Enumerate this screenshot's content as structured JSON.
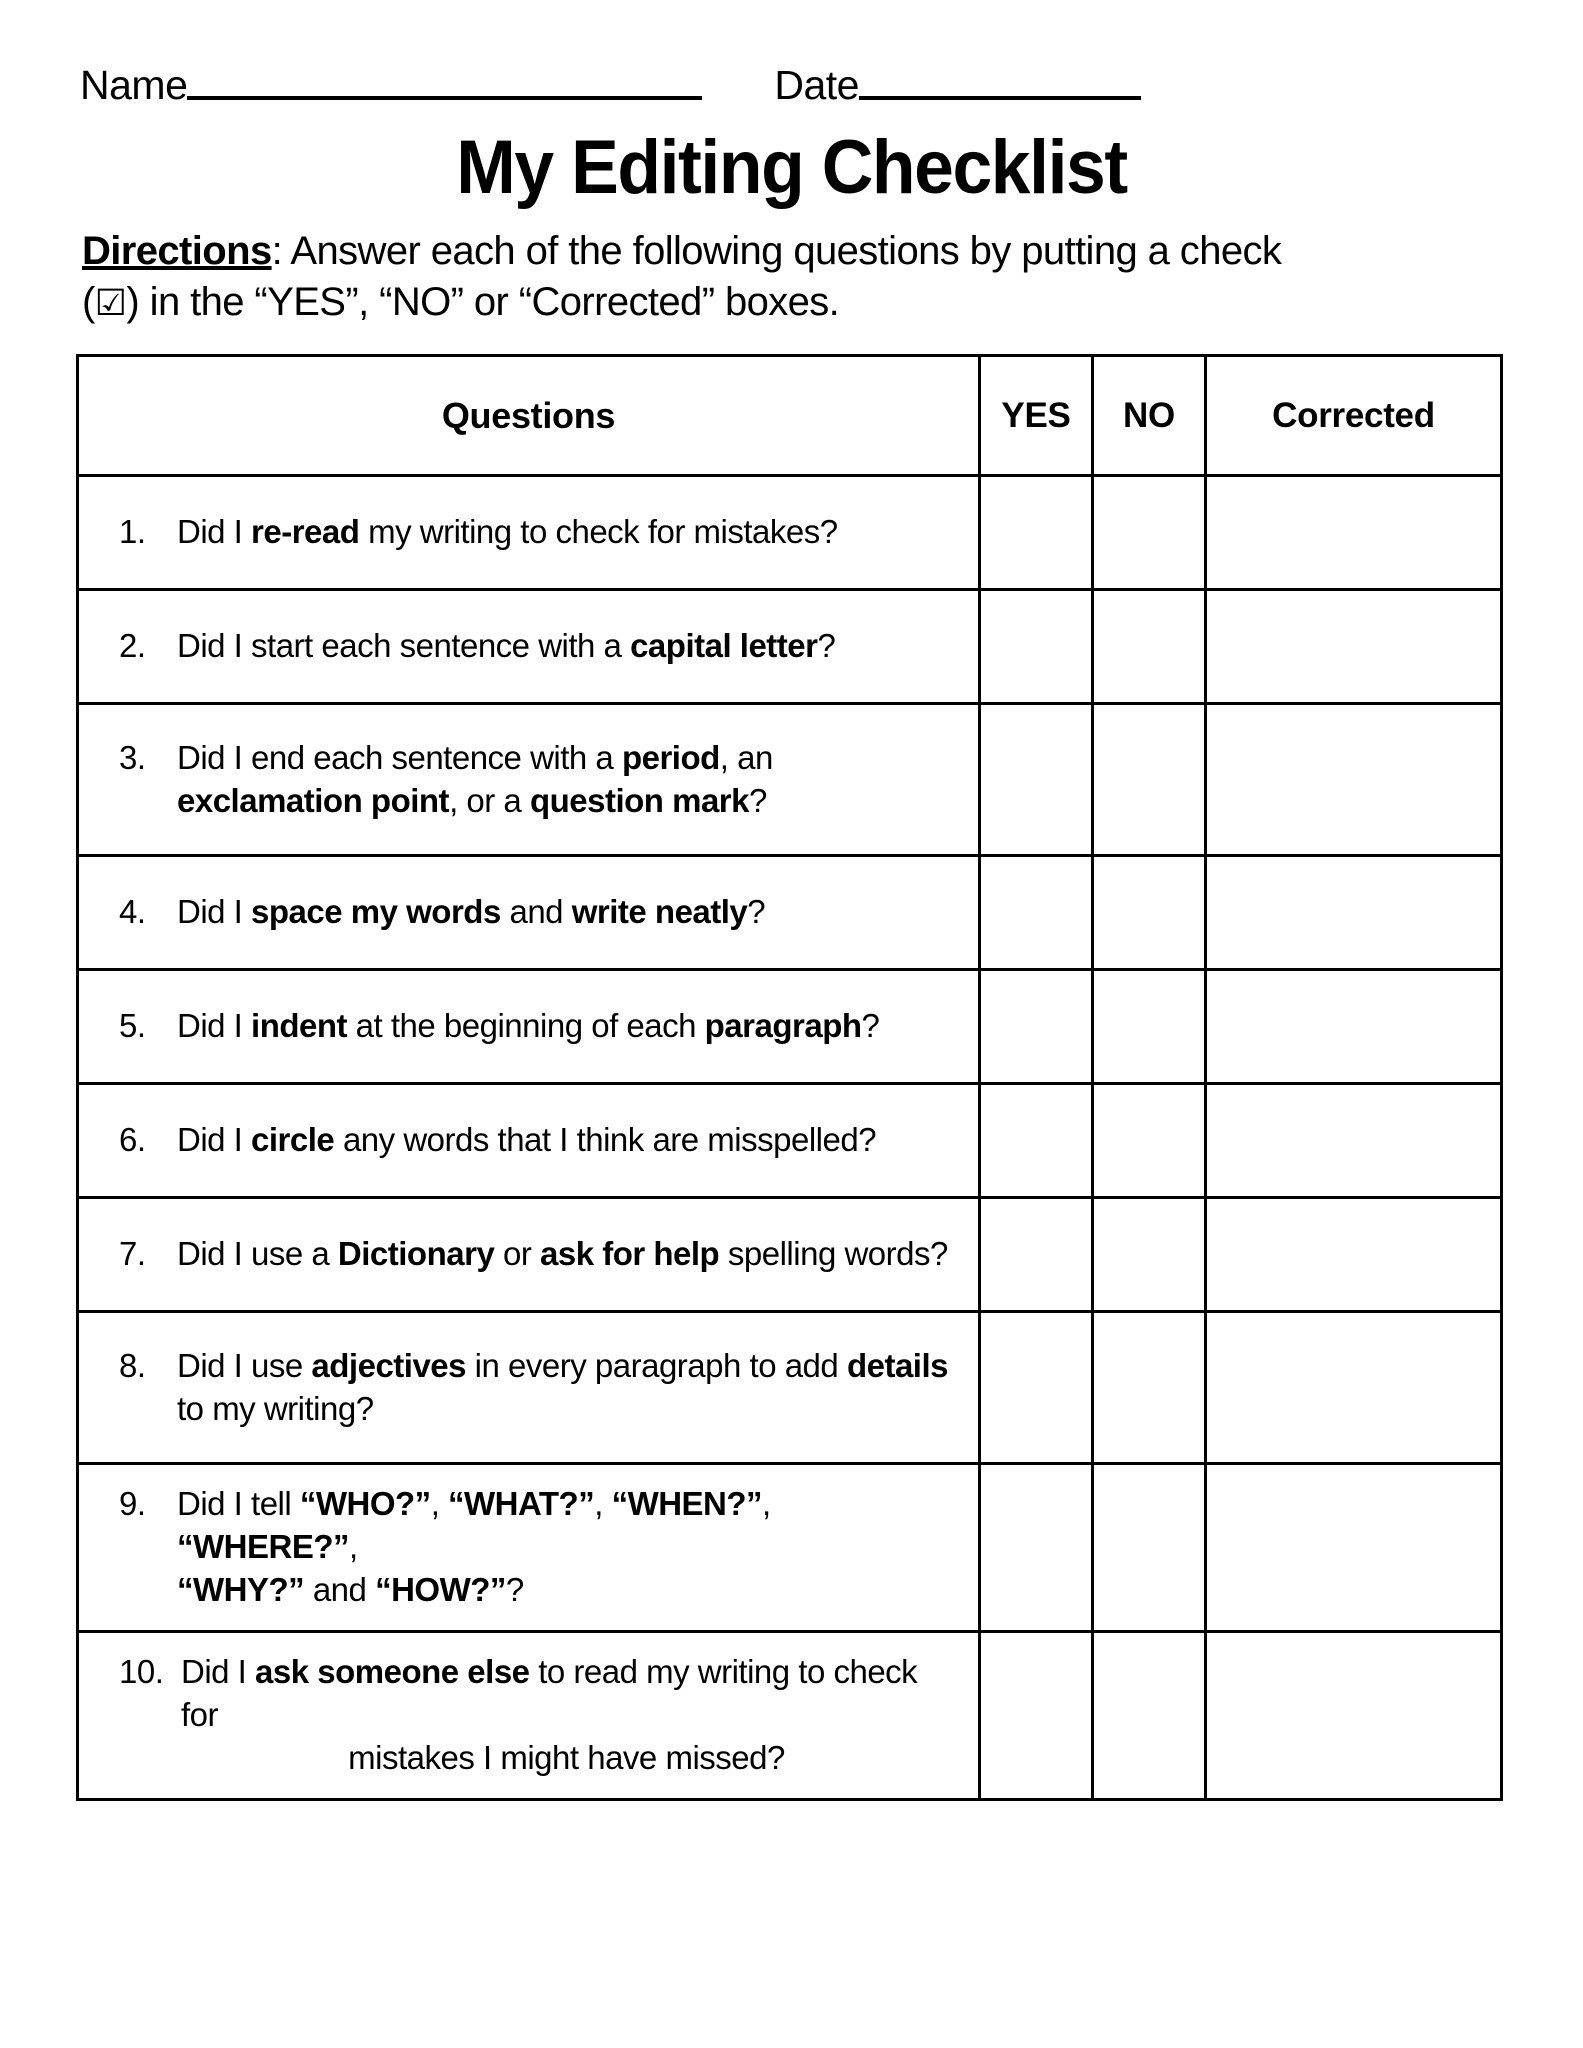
{
  "header": {
    "name_label": "Name",
    "date_label": "Date"
  },
  "title": "My Editing Checklist",
  "directions": {
    "label": "Directions",
    "colon": ":",
    "line1_rest": " Answer each of the following questions by putting a check",
    "line2_open": "(",
    "checkbox_glyph": "☑",
    "line2_rest": ") in the “YES”, “NO” or “Corrected” boxes."
  },
  "table": {
    "columns": {
      "questions": "Questions",
      "yes": "YES",
      "no": "NO",
      "corrected": "Corrected"
    },
    "rows": [
      {
        "number": "1.",
        "line1_pre": "Did I ",
        "bold1": "re-read",
        "line1_post": " my writing to check for mistakes?"
      },
      {
        "number": "2.",
        "line1_pre": " Did I start each sentence with a ",
        "bold1": "capital letter",
        "line1_post": "?"
      },
      {
        "number": "3.",
        "line1_pre": "Did I end each sentence with a ",
        "bold1": "period",
        "line1_post": ", an ",
        "bold2": "exclamation point",
        "line2_mid": ", or a ",
        "bold3": "question mark",
        "line2_post": "?"
      },
      {
        "number": "4.",
        "line1_pre": "Did I ",
        "bold1": "space my words",
        "line1_mid": " and ",
        "bold2": "write neatly",
        "line1_post": "?"
      },
      {
        "number": "5.",
        "line1_pre": "Did I ",
        "bold1": "indent",
        "line1_mid": " at the beginning of each ",
        "bold2": "paragraph",
        "line1_post": "?"
      },
      {
        "number": "6.",
        "line1_pre": "Did I ",
        "bold1": "circle",
        "line1_post": " any words that I think are misspelled?"
      },
      {
        "number": "7.",
        "line1_pre": "Did I use a ",
        "bold1": "Dictionary",
        "line1_mid": " or ",
        "bold2": "ask for help",
        "line1_post": " spelling words?"
      },
      {
        "number": "8.",
        "line1_pre": "Did I use ",
        "bold1": "adjectives",
        "line1_mid": " in every paragraph to add ",
        "bold2": "details",
        "line2_post": "to my writing?"
      },
      {
        "number": "9.",
        "line1_pre": "Did I tell ",
        "bold1": "“WHO?”",
        "sep1": ", ",
        "bold2": "“WHAT?”",
        "sep2": ", ",
        "bold3": "“WHEN?”",
        "sep3": ", ",
        "bold4": "“WHERE?”",
        "sep4": ",",
        "bold5": "“WHY?”",
        "sep5": " and ",
        "bold6": "“HOW?”",
        "line2_post": "?"
      },
      {
        "number": "10.",
        "line1_pre": "Did I ",
        "bold1": "ask someone else",
        "line1_post": " to read my writing to check for",
        "line2": "mistakes I might have missed?"
      }
    ]
  }
}
